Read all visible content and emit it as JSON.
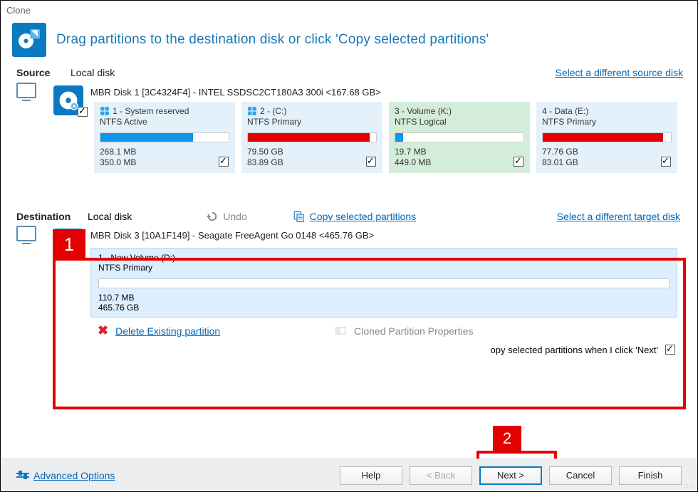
{
  "window_title": "Clone",
  "header_msg": "Drag partitions to the destination disk or click 'Copy selected partitions'",
  "source": {
    "label": "Source",
    "location": "Local disk",
    "select_other": "Select a different source disk",
    "disk_title": "MBR Disk 1 [3C4324F4] - INTEL SSDSC2CT180A3 300i  <167.68 GB>",
    "partitions": [
      {
        "title": "1 -  System reserved",
        "type": "NTFS Active",
        "fill_pct": 72,
        "fill_color": "#0f98e9",
        "used": "268.1 MB",
        "total": "350.0 MB",
        "variant": "blue",
        "icon": "win"
      },
      {
        "title": "2 -  (C:)",
        "type": "NTFS Primary",
        "fill_pct": 95,
        "fill_color": "#e30000",
        "used": "79.50 GB",
        "total": "83.89 GB",
        "variant": "blue",
        "icon": "win"
      },
      {
        "title": "3 - Volume (K:)",
        "type": "NTFS Logical",
        "fill_pct": 6,
        "fill_color": "#0f98e9",
        "used": "19.7 MB",
        "total": "449.0 MB",
        "variant": "green",
        "icon": ""
      },
      {
        "title": "4 - Data   (E:)",
        "type": "NTFS Primary",
        "fill_pct": 94,
        "fill_color": "#e30000",
        "used": "77.76 GB",
        "total": "83.01 GB",
        "variant": "blue",
        "icon": ""
      }
    ]
  },
  "destination": {
    "label": "Destination",
    "location": "Local disk",
    "undo": "Undo",
    "copy": "Copy selected partitions",
    "select_other": "Select a different target disk",
    "disk_title": "MBR Disk 3 [10A1F149] - Seagate  FreeAgent Go      0148  <465.76 GB>",
    "partition": {
      "title": "1 - New Volume (D:)",
      "type": "NTFS Primary",
      "fill_pct": 0.05,
      "used": "110.7 MB",
      "total": "465.76 GB"
    }
  },
  "actions": {
    "delete_existing": "Delete Existing partition",
    "cloned_props": "Cloned Partition Properties",
    "copy_on_next": "opy selected partitions when I click 'Next'"
  },
  "footer": {
    "advanced": "Advanced Options",
    "help": "Help",
    "back": "<  Back",
    "next": "Next  >",
    "cancel": "Cancel",
    "finish": "Finish"
  },
  "annotations": {
    "box1": "1",
    "box2": "2"
  }
}
